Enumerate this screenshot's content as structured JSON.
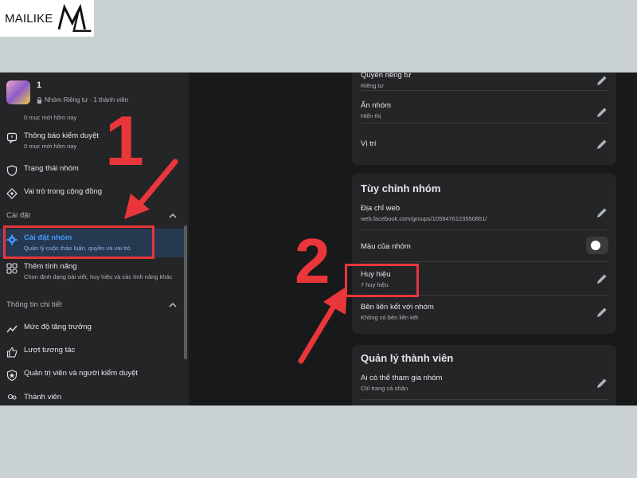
{
  "brand": {
    "name": "MAILIKE"
  },
  "group": {
    "name": "1",
    "privacy": "Nhóm Riêng tư · 1 thành viên"
  },
  "sidebar": {
    "truncated_sub": "0 mục mới hôm nay",
    "items": [
      {
        "title": "Thông báo kiểm duyệt",
        "sub": "0 mục mới hôm nay",
        "icon": "moderation-alert-icon"
      },
      {
        "title": "Trạng thái nhóm",
        "icon": "shield-icon"
      },
      {
        "title": "Vai trò trong cộng đồng",
        "icon": "diamond-icon"
      }
    ],
    "section_settings": "Cài đặt",
    "settings_active": {
      "title": "Cài đặt nhóm",
      "sub": "Quản lý cuộc thảo luận, quyền và vai trò"
    },
    "add_features": {
      "title": "Thêm tính năng",
      "sub": "Chọn định dạng bài viết, huy hiệu và các tính năng khác"
    },
    "section_details": "Thông tin chi tiết",
    "details": [
      {
        "title": "Mức độ tăng trưởng",
        "icon": "growth-icon"
      },
      {
        "title": "Lượt tương tác",
        "icon": "thumbs-up-icon"
      },
      {
        "title": "Quản trị viên và người kiểm duyệt",
        "icon": "admin-badge-icon"
      },
      {
        "title": "Thành viên",
        "icon": "members-icon"
      }
    ]
  },
  "privacy_card": {
    "rows": [
      {
        "title": "Quyền riêng tư",
        "sub": "Riêng tư"
      },
      {
        "title": "Ẩn nhóm",
        "sub": "Hiển thị"
      },
      {
        "title": "Vị trí",
        "sub": ""
      }
    ]
  },
  "customize_card": {
    "heading": "Tùy chỉnh nhóm",
    "rows": [
      {
        "title": "Địa chỉ web",
        "sub": "web.facebook.com/groups/1059476123550851/"
      },
      {
        "title": "Màu của nhóm",
        "sub": ""
      },
      {
        "title": "Huy hiệu",
        "sub": "7 huy hiệu"
      },
      {
        "title": "Bên liên kết với nhóm",
        "sub": "Không có bên liên kết"
      }
    ]
  },
  "members_card": {
    "heading": "Quản lý thành viên",
    "rows": [
      {
        "title": "Ai có thể tham gia nhóm",
        "sub": "Chỉ trang cá nhân"
      }
    ]
  },
  "annotations": {
    "step1": "1",
    "step2": "2"
  },
  "colors": {
    "accent": "#4599ff",
    "annotation": "#e8363a",
    "panel": "#242526",
    "background": "#18191a"
  }
}
